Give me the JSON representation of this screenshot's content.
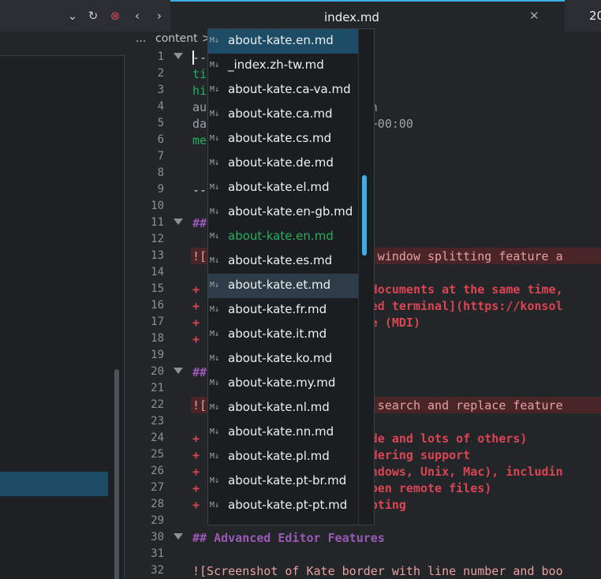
{
  "window": {
    "tab_title": "index.md",
    "next_tab_text": "20"
  },
  "toolbar": {
    "dropdown_icon": "chevron-down-icon",
    "reload_icon": "reload-icon",
    "stop_icon": "stop-icon",
    "back_icon": "chevron-left-icon",
    "forward_icon": "chevron-right-icon"
  },
  "breadcrumb": {
    "dots": "...",
    "content": "content",
    "separator": ">"
  },
  "editor": {
    "lines": [
      {
        "n": "1",
        "fold": true,
        "text": "--"
      },
      {
        "n": "2",
        "fold": false,
        "text": "ti"
      },
      {
        "n": "3",
        "fold": false,
        "text": "hi"
      },
      {
        "n": "4",
        "fold": false,
        "text": "au                     ann"
      },
      {
        "n": "5",
        "fold": false,
        "text": "da                     19+00:00"
      },
      {
        "n": "6",
        "fold": false,
        "text": "me"
      },
      {
        "n": "7",
        "fold": false,
        "text": ""
      },
      {
        "n": "8",
        "fold": false,
        "text": ""
      },
      {
        "n": "9",
        "fold": false,
        "text": "--"
      },
      {
        "n": "10",
        "fold": false,
        "text": ""
      },
      {
        "n": "11",
        "fold": true,
        "text": "##"
      },
      {
        "n": "12",
        "fold": false,
        "text": ""
      },
      {
        "n": "13",
        "fold": false,
        "text": "![                     te window splitting feature a"
      },
      {
        "n": "14",
        "fold": false,
        "text": ""
      },
      {
        "n": "15",
        "fold": false,
        "text": "+                      e documents at the same time,"
      },
      {
        "n": "16",
        "fold": false,
        "text": "+                      dded terminal](https://konsol"
      },
      {
        "n": "17",
        "fold": false,
        "text": "+                      ace (MDI)"
      },
      {
        "n": "18",
        "fold": false,
        "text": "+"
      },
      {
        "n": "19",
        "fold": false,
        "text": ""
      },
      {
        "n": "20",
        "fold": true,
        "text": "##"
      },
      {
        "n": "21",
        "fold": false,
        "text": ""
      },
      {
        "n": "22",
        "fold": false,
        "text": "![                     te search and replace feature"
      },
      {
        "n": "23",
        "fold": false,
        "text": ""
      },
      {
        "n": "24",
        "fold": false,
        "text": "+                      code and lots of others)"
      },
      {
        "n": "25",
        "fold": false,
        "text": "+                      endering support"
      },
      {
        "n": "26",
        "fold": false,
        "text": "+                      Windows, Unix, Mac), includin"
      },
      {
        "n": "27",
        "fold": false,
        "text": "+                      (open remote files)"
      },
      {
        "n": "28",
        "fold": false,
        "text": "+                      ripting"
      },
      {
        "n": "29",
        "fold": false,
        "text": ""
      },
      {
        "n": "30",
        "fold": true,
        "text": "## Advanced Editor Features"
      },
      {
        "n": "31",
        "fold": false,
        "text": ""
      },
      {
        "n": "32",
        "fold": false,
        "text": "![Screenshot of Kate border with line number and boo"
      }
    ]
  },
  "completion": {
    "icon": "markdown-file-icon",
    "badge": "M↓",
    "items": [
      {
        "label": "about-kate.en.md",
        "state": "top"
      },
      {
        "label": "_index.zh-tw.md",
        "state": ""
      },
      {
        "label": "about-kate.ca-va.md",
        "state": ""
      },
      {
        "label": "about-kate.ca.md",
        "state": ""
      },
      {
        "label": "about-kate.cs.md",
        "state": ""
      },
      {
        "label": "about-kate.de.md",
        "state": ""
      },
      {
        "label": "about-kate.el.md",
        "state": ""
      },
      {
        "label": "about-kate.en-gb.md",
        "state": ""
      },
      {
        "label": "about-kate.en.md",
        "state": "current"
      },
      {
        "label": "about-kate.es.md",
        "state": ""
      },
      {
        "label": "about-kate.et.md",
        "state": "hl"
      },
      {
        "label": "about-kate.fr.md",
        "state": ""
      },
      {
        "label": "about-kate.it.md",
        "state": ""
      },
      {
        "label": "about-kate.ko.md",
        "state": ""
      },
      {
        "label": "about-kate.my.md",
        "state": ""
      },
      {
        "label": "about-kate.nl.md",
        "state": ""
      },
      {
        "label": "about-kate.nn.md",
        "state": ""
      },
      {
        "label": "about-kate.pl.md",
        "state": ""
      },
      {
        "label": "about-kate.pt-br.md",
        "state": ""
      },
      {
        "label": "about-kate.pt-pt.md",
        "state": ""
      }
    ]
  },
  "colors": {
    "accent": "#3daee9",
    "selection": "#1d4c66",
    "heading": "#9b59b6",
    "added": "#da4453",
    "current_file": "#27ae60"
  }
}
